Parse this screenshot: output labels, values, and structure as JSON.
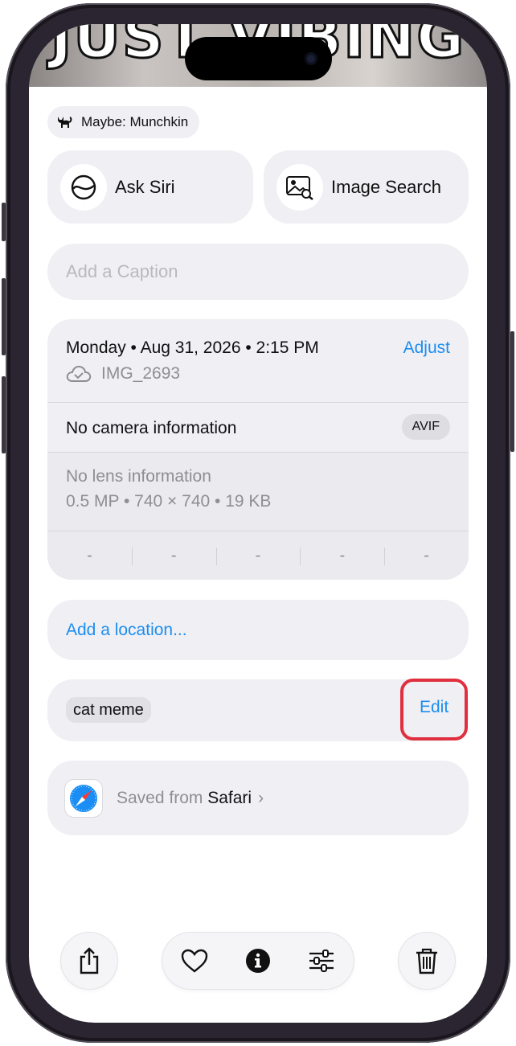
{
  "photo": {
    "meme_text": "JUST VIBING"
  },
  "animal_pill": {
    "icon": "cat-icon",
    "label": "Maybe: Munchkin"
  },
  "actions": [
    {
      "icon": "siri-icon",
      "label": "Ask Siri"
    },
    {
      "icon": "image-search-icon",
      "label": "Image Search"
    }
  ],
  "caption": {
    "placeholder": "Add a Caption"
  },
  "info": {
    "date": "Monday • Aug 31, 2026 • 2:15 PM",
    "adjust_label": "Adjust",
    "filename": "IMG_2693",
    "camera": "No camera information",
    "format_badge": "AVIF",
    "lens": "No lens information",
    "specs": "0.5 MP • 740 × 740 • 19 KB",
    "exif": [
      "-",
      "-",
      "-",
      "-",
      "-"
    ]
  },
  "location": {
    "label": "Add a location..."
  },
  "tags": {
    "items": [
      "cat meme"
    ],
    "edit_label": "Edit"
  },
  "source": {
    "prefix": "Saved from ",
    "app": "Safari"
  },
  "colors": {
    "accent": "#1c8ef0",
    "highlight": "#e0303f",
    "card": "#efeff4"
  }
}
